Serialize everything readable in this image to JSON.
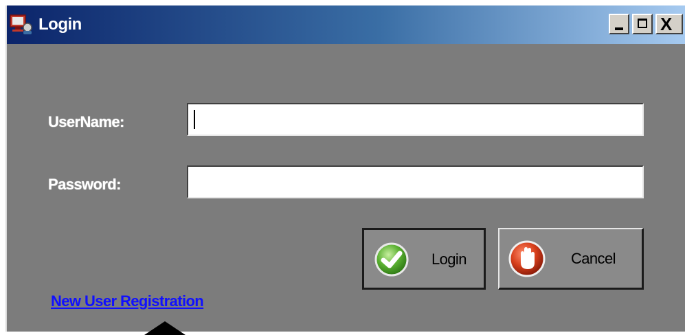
{
  "window": {
    "title": "Login",
    "icon": "login-app-icon",
    "controls": {
      "minimize_icon": "minimize-icon",
      "maximize_icon": "maximize-icon",
      "close_icon": "close-icon",
      "close_glyph": "X"
    }
  },
  "form": {
    "username_label": "UserName:",
    "username_value": "",
    "password_label": "Password:",
    "password_value": ""
  },
  "buttons": {
    "login_label": "Login",
    "login_icon": "checkmark-icon",
    "cancel_label": "Cancel",
    "cancel_icon": "stop-hand-icon"
  },
  "links": {
    "register_label": "New User Registration"
  },
  "colors": {
    "window_bg": "#7c7c7c",
    "titlebar_start": "#0b246a",
    "titlebar_end": "#a6caf0",
    "link": "#1010ff",
    "login_icon_green": "#5ab031",
    "cancel_icon_red": "#d8401c"
  }
}
